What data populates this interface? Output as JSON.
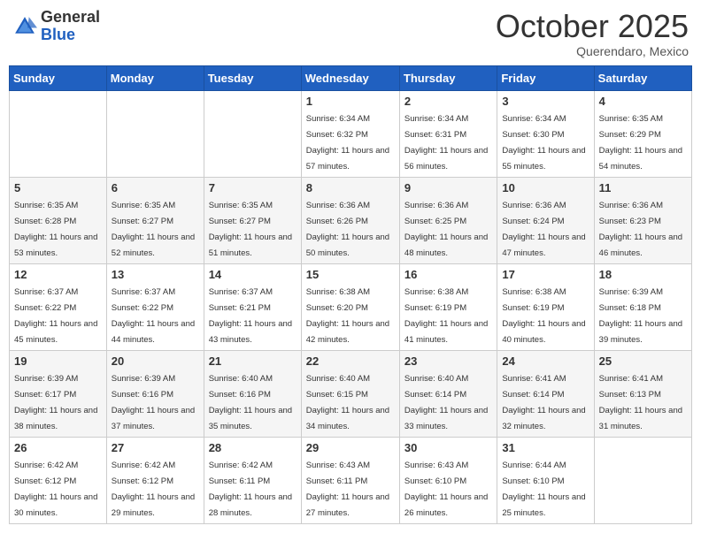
{
  "header": {
    "logo_general": "General",
    "logo_blue": "Blue",
    "month_title": "October 2025",
    "subtitle": "Querendaro, Mexico"
  },
  "days_of_week": [
    "Sunday",
    "Monday",
    "Tuesday",
    "Wednesday",
    "Thursday",
    "Friday",
    "Saturday"
  ],
  "weeks": [
    [
      {
        "day": "",
        "sunrise": "",
        "sunset": "",
        "daylight": ""
      },
      {
        "day": "",
        "sunrise": "",
        "sunset": "",
        "daylight": ""
      },
      {
        "day": "",
        "sunrise": "",
        "sunset": "",
        "daylight": ""
      },
      {
        "day": "1",
        "sunrise": "6:34 AM",
        "sunset": "6:32 PM",
        "daylight": "11 hours and 57 minutes."
      },
      {
        "day": "2",
        "sunrise": "6:34 AM",
        "sunset": "6:31 PM",
        "daylight": "11 hours and 56 minutes."
      },
      {
        "day": "3",
        "sunrise": "6:34 AM",
        "sunset": "6:30 PM",
        "daylight": "11 hours and 55 minutes."
      },
      {
        "day": "4",
        "sunrise": "6:35 AM",
        "sunset": "6:29 PM",
        "daylight": "11 hours and 54 minutes."
      }
    ],
    [
      {
        "day": "5",
        "sunrise": "6:35 AM",
        "sunset": "6:28 PM",
        "daylight": "11 hours and 53 minutes."
      },
      {
        "day": "6",
        "sunrise": "6:35 AM",
        "sunset": "6:27 PM",
        "daylight": "11 hours and 52 minutes."
      },
      {
        "day": "7",
        "sunrise": "6:35 AM",
        "sunset": "6:27 PM",
        "daylight": "11 hours and 51 minutes."
      },
      {
        "day": "8",
        "sunrise": "6:36 AM",
        "sunset": "6:26 PM",
        "daylight": "11 hours and 50 minutes."
      },
      {
        "day": "9",
        "sunrise": "6:36 AM",
        "sunset": "6:25 PM",
        "daylight": "11 hours and 48 minutes."
      },
      {
        "day": "10",
        "sunrise": "6:36 AM",
        "sunset": "6:24 PM",
        "daylight": "11 hours and 47 minutes."
      },
      {
        "day": "11",
        "sunrise": "6:36 AM",
        "sunset": "6:23 PM",
        "daylight": "11 hours and 46 minutes."
      }
    ],
    [
      {
        "day": "12",
        "sunrise": "6:37 AM",
        "sunset": "6:22 PM",
        "daylight": "11 hours and 45 minutes."
      },
      {
        "day": "13",
        "sunrise": "6:37 AM",
        "sunset": "6:22 PM",
        "daylight": "11 hours and 44 minutes."
      },
      {
        "day": "14",
        "sunrise": "6:37 AM",
        "sunset": "6:21 PM",
        "daylight": "11 hours and 43 minutes."
      },
      {
        "day": "15",
        "sunrise": "6:38 AM",
        "sunset": "6:20 PM",
        "daylight": "11 hours and 42 minutes."
      },
      {
        "day": "16",
        "sunrise": "6:38 AM",
        "sunset": "6:19 PM",
        "daylight": "11 hours and 41 minutes."
      },
      {
        "day": "17",
        "sunrise": "6:38 AM",
        "sunset": "6:19 PM",
        "daylight": "11 hours and 40 minutes."
      },
      {
        "day": "18",
        "sunrise": "6:39 AM",
        "sunset": "6:18 PM",
        "daylight": "11 hours and 39 minutes."
      }
    ],
    [
      {
        "day": "19",
        "sunrise": "6:39 AM",
        "sunset": "6:17 PM",
        "daylight": "11 hours and 38 minutes."
      },
      {
        "day": "20",
        "sunrise": "6:39 AM",
        "sunset": "6:16 PM",
        "daylight": "11 hours and 37 minutes."
      },
      {
        "day": "21",
        "sunrise": "6:40 AM",
        "sunset": "6:16 PM",
        "daylight": "11 hours and 35 minutes."
      },
      {
        "day": "22",
        "sunrise": "6:40 AM",
        "sunset": "6:15 PM",
        "daylight": "11 hours and 34 minutes."
      },
      {
        "day": "23",
        "sunrise": "6:40 AM",
        "sunset": "6:14 PM",
        "daylight": "11 hours and 33 minutes."
      },
      {
        "day": "24",
        "sunrise": "6:41 AM",
        "sunset": "6:14 PM",
        "daylight": "11 hours and 32 minutes."
      },
      {
        "day": "25",
        "sunrise": "6:41 AM",
        "sunset": "6:13 PM",
        "daylight": "11 hours and 31 minutes."
      }
    ],
    [
      {
        "day": "26",
        "sunrise": "6:42 AM",
        "sunset": "6:12 PM",
        "daylight": "11 hours and 30 minutes."
      },
      {
        "day": "27",
        "sunrise": "6:42 AM",
        "sunset": "6:12 PM",
        "daylight": "11 hours and 29 minutes."
      },
      {
        "day": "28",
        "sunrise": "6:42 AM",
        "sunset": "6:11 PM",
        "daylight": "11 hours and 28 minutes."
      },
      {
        "day": "29",
        "sunrise": "6:43 AM",
        "sunset": "6:11 PM",
        "daylight": "11 hours and 27 minutes."
      },
      {
        "day": "30",
        "sunrise": "6:43 AM",
        "sunset": "6:10 PM",
        "daylight": "11 hours and 26 minutes."
      },
      {
        "day": "31",
        "sunrise": "6:44 AM",
        "sunset": "6:10 PM",
        "daylight": "11 hours and 25 minutes."
      },
      {
        "day": "",
        "sunrise": "",
        "sunset": "",
        "daylight": ""
      }
    ]
  ]
}
